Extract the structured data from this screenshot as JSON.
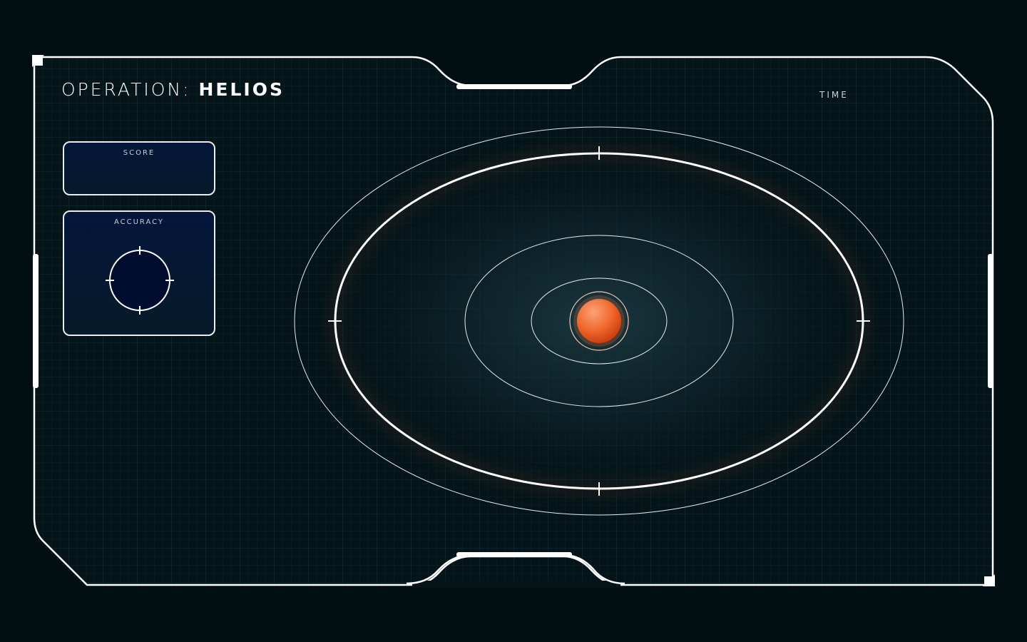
{
  "header": {
    "title_prefix": "OPERATION: ",
    "title_name": "HELIOS",
    "time_label": "TIME"
  },
  "score_panel": {
    "label": "SCORE",
    "value": ""
  },
  "accuracy_panel": {
    "label": "ACCURACY"
  },
  "colors": {
    "background": "#020f12",
    "frame": "#ffffff",
    "grid": "#0f2a2e",
    "panel_fill": "#04163a",
    "sun_core": "#f2682c",
    "sun_highlight": "#f9a37a"
  },
  "icons": [
    "crosshair-icon",
    "sun-icon"
  ]
}
